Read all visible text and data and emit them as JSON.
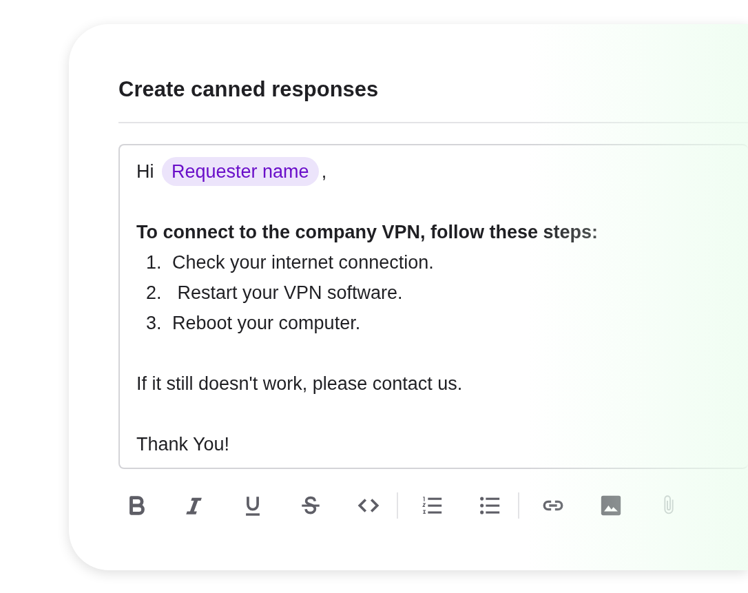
{
  "title": "Create canned responses",
  "editor": {
    "greeting": {
      "text": "Hi",
      "tag": "Requester name",
      "suffix": ","
    },
    "heading": "To connect to the company VPN, follow these steps:",
    "steps": [
      {
        "number": "1.",
        "text": "Check your internet connection."
      },
      {
        "number": "2.",
        "text": " Restart your VPN software."
      },
      {
        "number": "3.",
        "text": "Reboot your computer."
      }
    ],
    "paragraphs": [
      "If it still doesn't work, please contact us.",
      "Thank You!"
    ]
  },
  "toolbar": [
    [
      {
        "disabled": false
      },
      {
        "disabled": false
      },
      {
        "disabled": false
      },
      {
        "disabled": false
      },
      {
        "disabled": false
      }
    ],
    [
      {
        "disabled": false
      },
      {
        "disabled": false
      }
    ],
    [
      {
        "disabled": false
      },
      {
        "disabled": false
      },
      {
        "disabled": true
      }
    ]
  ]
}
